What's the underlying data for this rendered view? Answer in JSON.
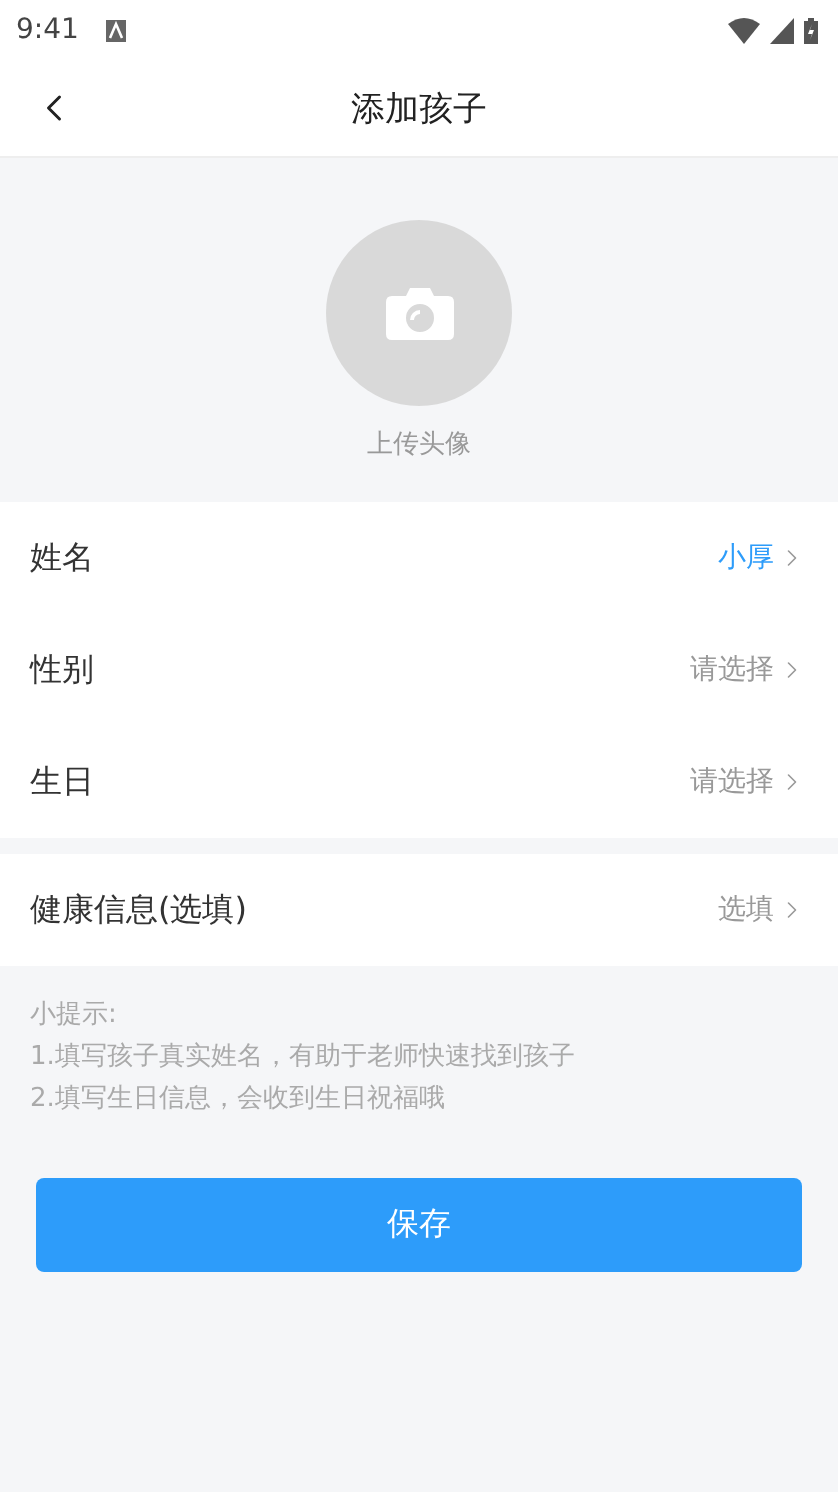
{
  "status_bar": {
    "time": "9:41"
  },
  "header": {
    "title": "添加孩子"
  },
  "avatar": {
    "label": "上传头像"
  },
  "groups": [
    {
      "rows": [
        {
          "label": "姓名",
          "value": "小厚",
          "filled": true
        },
        {
          "label": "性别",
          "value": "请选择",
          "filled": false
        },
        {
          "label": "生日",
          "value": "请选择",
          "filled": false
        }
      ]
    },
    {
      "rows": [
        {
          "label": "健康信息(选填)",
          "value": "选填",
          "filled": false
        }
      ]
    }
  ],
  "tips": [
    "小提示:",
    "1.填写孩子真实姓名，有助于老师快速找到孩子",
    "2.填写生日信息，会收到生日祝福哦"
  ],
  "save_button": {
    "label": "保存"
  }
}
